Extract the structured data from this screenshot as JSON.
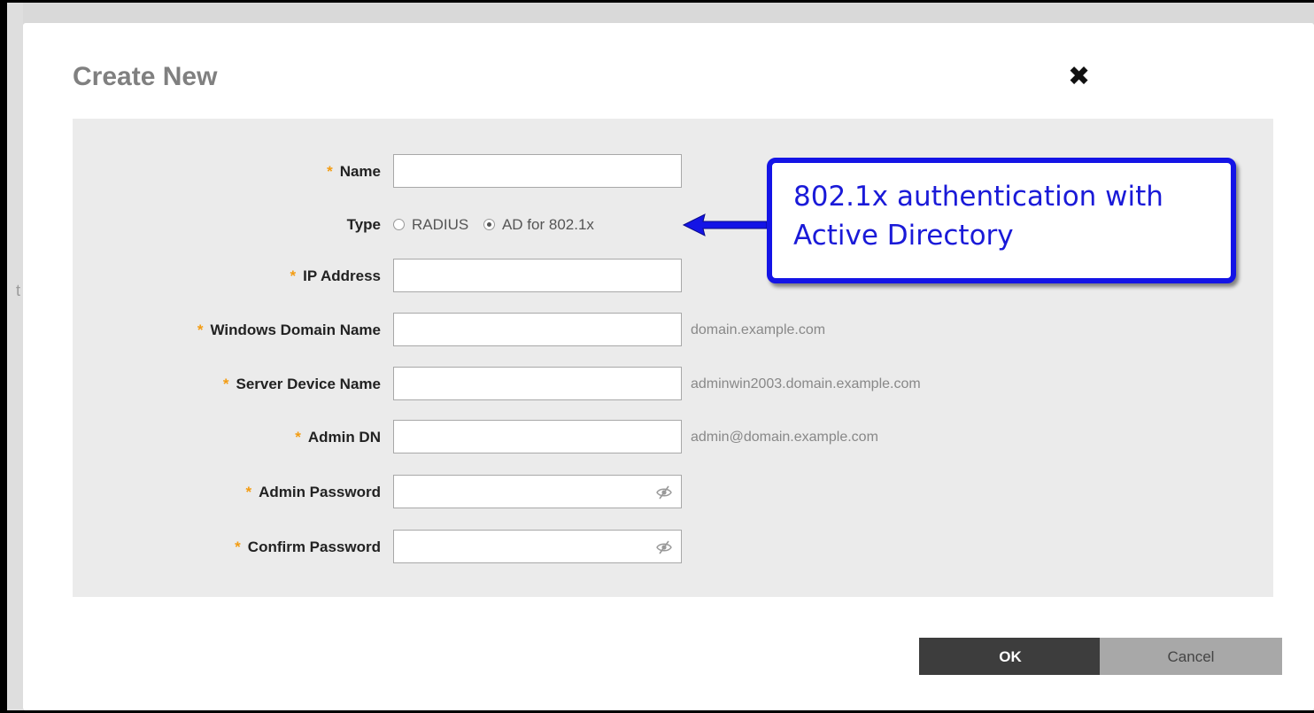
{
  "dialog": {
    "title": "Create New",
    "close_label": "✖"
  },
  "form": {
    "required_mark": "*",
    "name": {
      "label": "Name",
      "value": ""
    },
    "type": {
      "label": "Type",
      "options": [
        "RADIUS",
        "AD for 802.1x"
      ],
      "selected": "AD for 802.1x"
    },
    "ip_address": {
      "label": "IP Address",
      "value": ""
    },
    "windows_domain_name": {
      "label": "Windows Domain Name",
      "value": "",
      "hint": "domain.example.com"
    },
    "server_device_name": {
      "label": "Server Device Name",
      "value": "",
      "hint": "adminwin2003.domain.example.com"
    },
    "admin_dn": {
      "label": "Admin DN",
      "value": "",
      "hint": "admin@domain.example.com"
    },
    "admin_password": {
      "label": "Admin Password",
      "value": ""
    },
    "confirm_password": {
      "label": "Confirm Password",
      "value": ""
    }
  },
  "buttons": {
    "ok": "OK",
    "cancel": "Cancel"
  },
  "callout": {
    "text": "802.1x authentication with Active Directory",
    "color": "#1414e6"
  },
  "background": {
    "partial_letter": "t"
  },
  "colors": {
    "required": "#f39c12",
    "ok_button": "#3d3d3d",
    "cancel_button": "#a8a8a8",
    "panel": "#ebebeb"
  },
  "icons": {
    "close": "close-icon",
    "password_toggle": "eye-slash-icon",
    "arrow": "arrow-left-icon"
  }
}
